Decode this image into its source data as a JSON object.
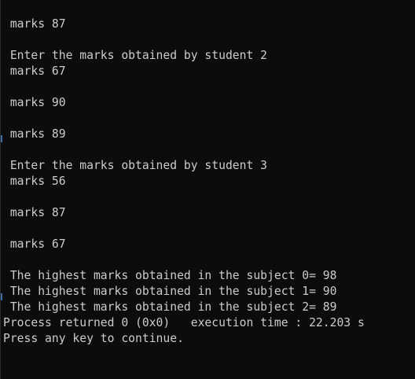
{
  "console": {
    "lines": [
      " marks 87",
      "",
      " Enter the marks obtained by student 2",
      " marks 67",
      "",
      " marks 90",
      "",
      " marks 89",
      "",
      " Enter the marks obtained by student 3",
      " marks 56",
      "",
      " marks 87",
      "",
      " marks 67",
      "",
      " The highest marks obtained in the subject 0= 98",
      " The highest marks obtained in the subject 1= 90",
      " The highest marks obtained in the subject 2= 89",
      "Process returned 0 (0x0)   execution time : 22.203 s",
      "Press any key to continue."
    ]
  },
  "colors": {
    "background": "#0c0c0c",
    "text": "#cccccc"
  }
}
